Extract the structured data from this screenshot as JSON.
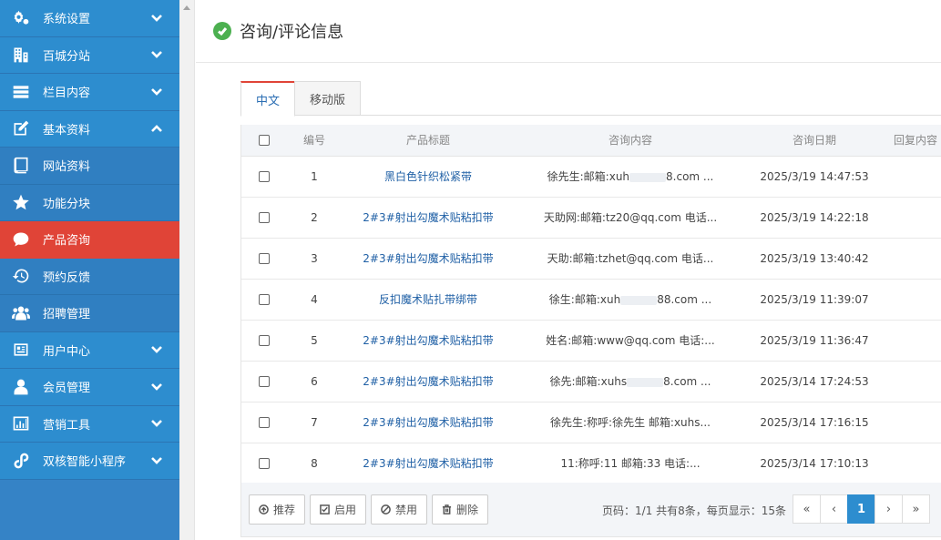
{
  "sidebar": {
    "items": [
      {
        "label": "系统设置",
        "icon": "gears-icon"
      },
      {
        "label": "百城分站",
        "icon": "building-icon"
      },
      {
        "label": "栏目内容",
        "icon": "list-bars-icon"
      },
      {
        "label": "基本资料",
        "icon": "edit-icon"
      },
      {
        "label": "网站资料",
        "icon": "book-icon"
      },
      {
        "label": "功能分块",
        "icon": "star-icon"
      },
      {
        "label": "产品咨询",
        "icon": "chat-bubble-icon"
      },
      {
        "label": "预约反馈",
        "icon": "history-icon"
      },
      {
        "label": "招聘管理",
        "icon": "users-icon"
      },
      {
        "label": "用户中心",
        "icon": "id-card-icon"
      },
      {
        "label": "会员管理",
        "icon": "user-icon"
      },
      {
        "label": "营销工具",
        "icon": "bar-chart-icon"
      },
      {
        "label": "双核智能小程序",
        "icon": "mini-program-icon"
      }
    ]
  },
  "header": {
    "title": "咨询/评论信息"
  },
  "tabs": [
    "中文",
    "移动版"
  ],
  "table": {
    "columns": [
      "编号",
      "产品标题",
      "咨询内容",
      "咨询日期",
      "回复内容"
    ],
    "rows": [
      {
        "id": "1",
        "title": "黑白色针织松紧带",
        "content_a": "徐先生:邮箱:xuh",
        "content_b": "8.com ...",
        "date": "2025/3/19 14:47:53"
      },
      {
        "id": "2",
        "title": "2#3#射出勾魔术贴粘扣带",
        "content_a": "天助网:邮箱:tz20@qq.com 电话...",
        "content_b": "",
        "date": "2025/3/19 14:22:18"
      },
      {
        "id": "3",
        "title": "2#3#射出勾魔术贴粘扣带",
        "content_a": "天助:邮箱:tzhet@qq.com 电话...",
        "content_b": "",
        "date": "2025/3/19 13:40:42"
      },
      {
        "id": "4",
        "title": "反扣魔术贴扎带绑带",
        "content_a": "徐生:邮箱:xuh",
        "content_b": "88.com ...",
        "date": "2025/3/19 11:39:07"
      },
      {
        "id": "5",
        "title": "2#3#射出勾魔术贴粘扣带",
        "content_a": "姓名:邮箱:www@qq.com 电话:...",
        "content_b": "",
        "date": "2025/3/19 11:36:47"
      },
      {
        "id": "6",
        "title": "2#3#射出勾魔术贴粘扣带",
        "content_a": "徐先:邮箱:xuhs",
        "content_b": "8.com ...",
        "date": "2025/3/14 17:24:53"
      },
      {
        "id": "7",
        "title": "2#3#射出勾魔术贴粘扣带",
        "content_a": "徐先生:称呼:徐先生 邮箱:xuhs...",
        "content_b": "",
        "date": "2025/3/14 17:16:15"
      },
      {
        "id": "8",
        "title": "2#3#射出勾魔术贴粘扣带",
        "content_a": "11:称呼:11 邮箱:33 电话:...",
        "content_b": "",
        "date": "2025/3/14 17:10:13"
      }
    ]
  },
  "footer": {
    "buttons": [
      "推荐",
      "启用",
      "禁用",
      "删除"
    ],
    "page_info": "页码：1/1 共有8条，每页显示：15条",
    "pager": {
      "first": "«",
      "prev": "‹",
      "current": "1",
      "next": "›",
      "last": "»"
    }
  },
  "colors": {
    "sidebar": "#2d8dcf",
    "active": "#e04437",
    "link": "#2161a6",
    "success": "#4cb050"
  }
}
